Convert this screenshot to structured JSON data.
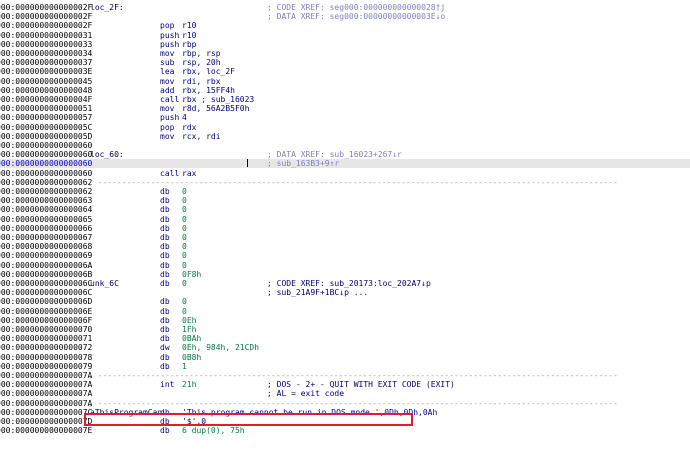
{
  "lines": [
    {
      "addr": "000:000000000000002F",
      "label": "loc_2F:",
      "comment": "; CODE XREF: seg000:000000000000028†j"
    },
    {
      "addr": "000:000000000000002F",
      "comment": "; DATA XREF: seg000:00000000000003E↓o"
    },
    {
      "addr": "000:000000000000002F",
      "mnem": "pop",
      "ops": "r10"
    },
    {
      "addr": "000:0000000000000031",
      "mnem": "push",
      "ops": "r10"
    },
    {
      "addr": "000:0000000000000033",
      "mnem": "push",
      "ops": "rbp"
    },
    {
      "addr": "000:0000000000000034",
      "mnem": "mov",
      "ops": "rbp, rsp"
    },
    {
      "addr": "000:0000000000000037",
      "mnem": "sub",
      "ops": "rsp, 20h"
    },
    {
      "addr": "000:000000000000003E",
      "mnem": "lea",
      "ops": "rbx, loc_2F"
    },
    {
      "addr": "000:0000000000000045",
      "mnem": "mov",
      "ops": "rdi, rbx"
    },
    {
      "addr": "000:0000000000000048",
      "mnem": "add",
      "ops": "rbx, 15FF4h"
    },
    {
      "addr": "000:000000000000004F",
      "mnem": "call",
      "ops": "rbx ; sub_16023"
    },
    {
      "addr": "000:0000000000000051",
      "mnem": "mov",
      "ops": "r8d, 56A2B5F0h"
    },
    {
      "addr": "000:0000000000000057",
      "mnem": "push",
      "ops": "4"
    },
    {
      "addr": "000:000000000000005C",
      "mnem": "pop",
      "ops": "rdx"
    },
    {
      "addr": "000:000000000000005D",
      "mnem": "mov",
      "ops": "rcx, rdi"
    },
    {
      "addr": "000:0000000000000060"
    },
    {
      "addr": "000:0000000000000060",
      "label": "loc_60:",
      "comment": "; DATA XREF: sub_16023+267↓r"
    },
    {
      "addr": "000:0000000000000060",
      "comment": "; sub_163B3+9↑r",
      "seg": true,
      "hl": true,
      "cursor": true
    },
    {
      "addr": "000:0000000000000060",
      "mnem": "call",
      "ops": "rax"
    },
    {
      "addr": "000:0000000000000062",
      "dashes": "; ------------------------------------------------------------------------------------------------------------"
    },
    {
      "addr": "000:0000000000000062",
      "mnem": "db",
      "ops": "0",
      "num": true
    },
    {
      "addr": "000:0000000000000063",
      "mnem": "db",
      "ops": "0",
      "num": true
    },
    {
      "addr": "000:0000000000000064",
      "mnem": "db",
      "ops": "0",
      "num": true
    },
    {
      "addr": "000:0000000000000065",
      "mnem": "db",
      "ops": "0",
      "num": true
    },
    {
      "addr": "000:0000000000000066",
      "mnem": "db",
      "ops": "0",
      "num": true
    },
    {
      "addr": "000:0000000000000067",
      "mnem": "db",
      "ops": "0",
      "num": true
    },
    {
      "addr": "000:0000000000000068",
      "mnem": "db",
      "ops": "0",
      "num": true
    },
    {
      "addr": "000:0000000000000069",
      "mnem": "db",
      "ops": "0",
      "num": true
    },
    {
      "addr": "000:000000000000006A",
      "mnem": "db",
      "ops": "0",
      "num": true
    },
    {
      "addr": "000:000000000000006B",
      "mnem": "db",
      "ops": "0F8h",
      "num": true
    },
    {
      "addr": "000:000000000000006C",
      "label": "unk_6C",
      "mnem": "db",
      "ops": "0",
      "num": true,
      "comment": "; CODE XREF: sub_20173:loc_202A7↓p",
      "cdark": true
    },
    {
      "addr": "000:000000000000006C",
      "comment": "; sub_21A9F+1BC↓p ...",
      "cdark": true
    },
    {
      "addr": "000:000000000000006D",
      "mnem": "db",
      "ops": "0",
      "num": true
    },
    {
      "addr": "000:000000000000006E",
      "mnem": "db",
      "ops": "0",
      "num": true
    },
    {
      "addr": "000:000000000000006F",
      "mnem": "db",
      "ops": "0Eh",
      "num": true
    },
    {
      "addr": "000:0000000000000070",
      "mnem": "db",
      "ops": "1Fh",
      "num": true
    },
    {
      "addr": "000:0000000000000071",
      "mnem": "db",
      "ops": "0BAh",
      "num": true
    },
    {
      "addr": "000:0000000000000072",
      "mnem": "dw",
      "ops": "0Eh, 984h, 21CDh",
      "num": true
    },
    {
      "addr": "000:0000000000000078",
      "mnem": "db",
      "ops": "0B8h",
      "num": true
    },
    {
      "addr": "000:0000000000000079",
      "mnem": "db",
      "ops": "1",
      "num": true
    },
    {
      "addr": "000:000000000000007A",
      "dashes": "; ------------------------------------------------------------------------------------------------------------"
    },
    {
      "addr": "000:000000000000007A",
      "mnem": "int",
      "ops": "21h",
      "num": true,
      "comment": "; DOS - 2+ - QUIT WITH EXIT CODE (EXIT)",
      "cdark": true
    },
    {
      "addr": "000:000000000000007A",
      "comment": "; AL = exit code",
      "cdark": true
    },
    {
      "addr": "000:000000000000007A",
      "dashes": "; ------------------------------------------------------------------------------------------------------------"
    },
    {
      "addr": "000:000000000000007C",
      "label": "aThisProgramCan",
      "mnem": "db",
      "ops": "'This program cannot be run in DOS mode.',0Dh,0Dh,0Ah",
      "str": true,
      "labelAt": 89
    },
    {
      "addr": "000:000000000000007D",
      "mnem": "db",
      "ops": "'$',0",
      "str": true
    },
    {
      "addr": "000:000000000000007E",
      "mnem": "db",
      "ops": "6 dup(0), 75h",
      "num": true
    }
  ]
}
